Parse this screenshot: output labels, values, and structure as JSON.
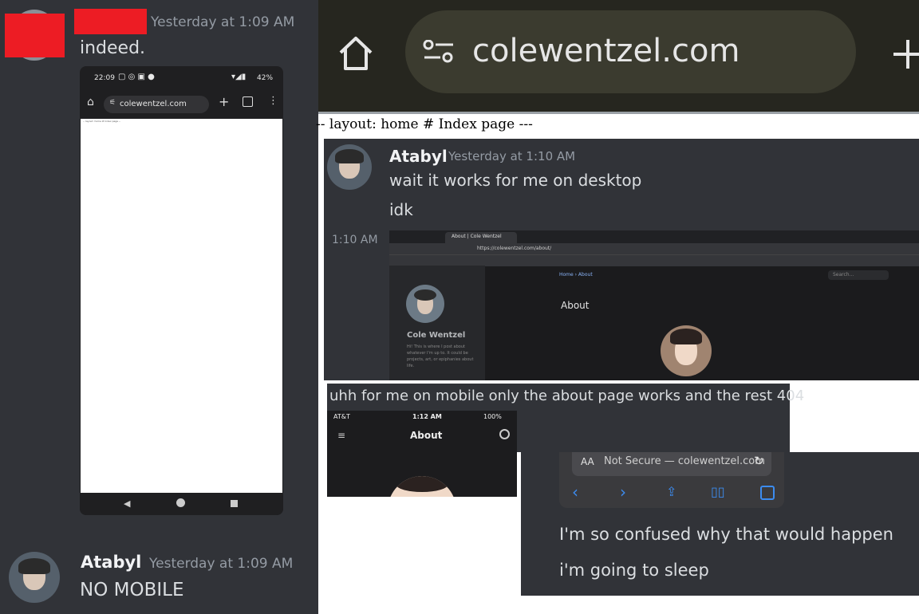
{
  "colors": {
    "discord_bg": "#313338",
    "browser_bar": "#26261f",
    "url_pill": "#3b3b2f",
    "redaction": "#ed1c24",
    "phone_bg": "#1f1f21"
  },
  "left": {
    "msg1": {
      "timestamp": "Yesterday at 1:09 AM",
      "text": "indeed."
    },
    "phone": {
      "time": "22:09",
      "status_right": "42%",
      "url": "colewentzel.com",
      "page_text": "-- layout: home # Index page --"
    },
    "msg2": {
      "author": "Atabyl",
      "timestamp": "Yesterday at 1:09 AM",
      "text": "NO MOBILE"
    }
  },
  "browser": {
    "url": "colewentzel.com",
    "icons": [
      "home-icon",
      "site-settings-icon",
      "new-tab-icon"
    ]
  },
  "raw_page_text": "-- layout: home # Index page ---",
  "chat_right": {
    "author": "Atabyl",
    "timestamp": "Yesterday at 1:10 AM",
    "line1": "wait it works for me on desktop",
    "line2": "idk",
    "time_hover": "1:10 AM",
    "desktop_shot": {
      "tab": "About | Cole Wentzel",
      "url": "https://colewentzel.com/about/",
      "breadcrumb": "Home › About",
      "heading": "About",
      "sidebar_name": "Cole Wentzel",
      "sidebar_blurb": "Hi! This is where I post about whatever I'm up to. It could be projects, art, or epiphanies about life.",
      "search": "Search..."
    }
  },
  "mobile_msg": {
    "text": "uhh for me on mobile only the about page works and the rest 404",
    "status_carrier": "AT&T",
    "status_time": "1:12 AM",
    "status_battery": "100%",
    "page_title": "About"
  },
  "safari": {
    "aa": "AA",
    "url": "Not Secure — colewentzel.com",
    "line1": "I'm so confused why that would happen",
    "line2": "i'm going to sleep"
  }
}
